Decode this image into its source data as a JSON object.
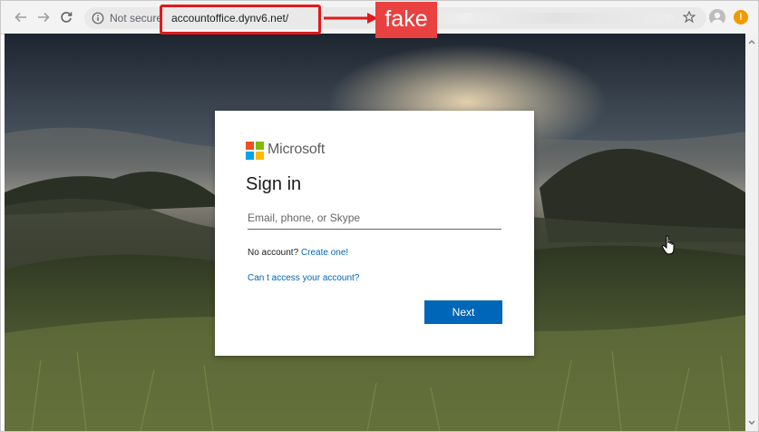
{
  "browser": {
    "security_label": "Not secure",
    "url": "accountoffice.dynv6.net/",
    "alert_symbol": "!"
  },
  "annotation": {
    "tag_label": "fake",
    "color": "#e0191b"
  },
  "signin": {
    "brand": "Microsoft",
    "title": "Sign in",
    "email_placeholder": "Email, phone, or Skype",
    "no_account_text": "No account?",
    "create_link": "Create one!",
    "cant_access_link": "Can t access your account?",
    "next_label": "Next",
    "accent_color": "#0067b8",
    "logo_colors": [
      "#f25022",
      "#7fba00",
      "#00a4ef",
      "#ffb900"
    ]
  }
}
